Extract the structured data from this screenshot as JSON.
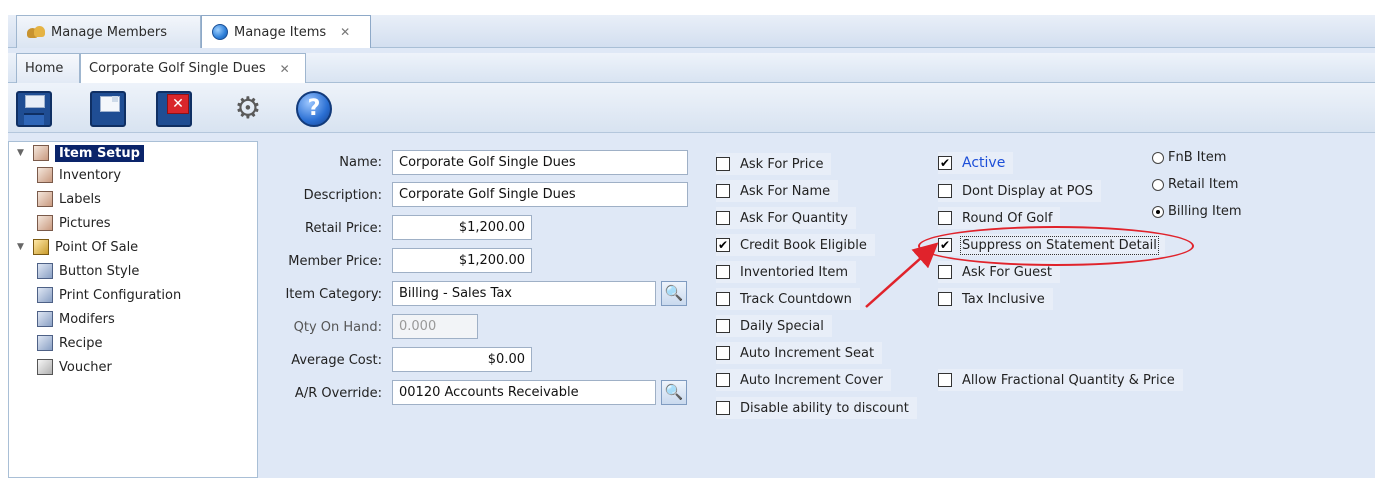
{
  "tabs": {
    "members_label": "Manage Members",
    "items_label": "Manage Items",
    "close_glyph": "✕"
  },
  "subtabs": {
    "home_label": "Home",
    "item_label": "Corporate Golf Single Dues",
    "close_glyph": "✕"
  },
  "toolbar": {
    "icons": [
      "save-icon",
      "new-icon",
      "delete-icon",
      "settings-icon",
      "help-icon"
    ],
    "gears_glyph": "⚙",
    "help_glyph": "?"
  },
  "tree": {
    "toggle_glyph": "▼",
    "items": [
      {
        "label": "Item Setup"
      },
      {
        "label": "Inventory"
      },
      {
        "label": "Labels"
      },
      {
        "label": "Pictures"
      },
      {
        "label": "Point Of Sale"
      },
      {
        "label": "Button Style"
      },
      {
        "label": "Print Configuration"
      },
      {
        "label": "Modifers"
      },
      {
        "label": "Recipe"
      },
      {
        "label": "Voucher"
      }
    ]
  },
  "form": {
    "name_label": "Name:",
    "name_value": "Corporate Golf Single Dues",
    "description_label": "Description:",
    "description_value": "Corporate Golf Single Dues",
    "retail_price_label": "Retail Price:",
    "retail_price_value": "$1,200.00",
    "member_price_label": "Member Price:",
    "member_price_value": "$1,200.00",
    "item_category_label": "Item Category:",
    "item_category_value": "Billing - Sales Tax",
    "qty_label": "Qty On Hand:",
    "qty_value": "0.000",
    "avg_cost_label": "Average Cost:",
    "avg_cost_value": "$0.00",
    "ar_override_label": "A/R Override:",
    "ar_override_value": "00120 Accounts Receivable",
    "lookup_glyph": "🔍"
  },
  "options_col1": [
    {
      "label": "Ask For Price",
      "checked": false
    },
    {
      "label": "Ask For Name",
      "checked": false
    },
    {
      "label": "Ask For Quantity",
      "checked": false
    },
    {
      "label": "Credit Book Eligible",
      "checked": true
    },
    {
      "label": "Inventoried Item",
      "checked": false
    },
    {
      "label": "Track Countdown",
      "checked": false
    },
    {
      "label": "Daily Special",
      "checked": false
    },
    {
      "label": "Auto Increment Seat",
      "checked": false
    },
    {
      "label": "Auto Increment Cover",
      "checked": false
    },
    {
      "label": "Disable ability to discount",
      "checked": false
    }
  ],
  "options_col2": [
    {
      "label": "Active",
      "checked": true
    },
    {
      "label": "Dont Display at POS",
      "checked": false
    },
    {
      "label": "Round Of Golf",
      "checked": false
    },
    {
      "label": "Suppress on Statement Detail",
      "checked": true
    },
    {
      "label": "Ask For Guest",
      "checked": false
    },
    {
      "label": "Tax Inclusive",
      "checked": false
    },
    {
      "label": "Allow Fractional Quantity & Price",
      "checked": false
    }
  ],
  "item_type": {
    "options": [
      "FnB Item",
      "Retail Item",
      "Billing Item"
    ],
    "selected": "Billing Item"
  },
  "check_glyph": "✔",
  "colors": {
    "selected_tree_bg": "#0a246a",
    "panel_bg": "#dfe8f6",
    "annotation_red": "#e0232b",
    "active_label_blue": "#1d4fd8"
  }
}
